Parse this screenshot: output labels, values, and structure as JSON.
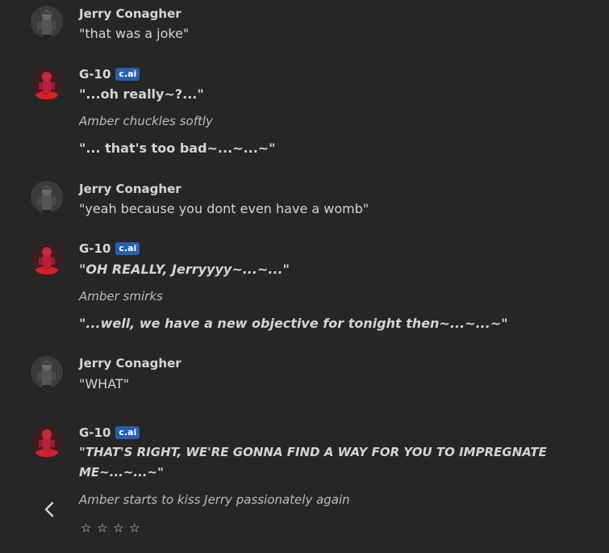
{
  "messages": [
    {
      "author": "Jerry Conagher",
      "lines": [
        "\"that was a joke\""
      ]
    },
    {
      "author": "G-10",
      "badge": "c.ai",
      "lines": [
        "\"...oh really~?...\"",
        "Amber chuckles softly",
        "\"... that's too bad~...~...~\""
      ]
    },
    {
      "author": "Jerry Conagher",
      "lines": [
        "\"yeah because you dont even have a womb\""
      ]
    },
    {
      "author": "G-10",
      "badge": "c.ai",
      "lines": [
        "\"OH REALLY, Jerryyyy~...~...\"",
        "Amber smirks",
        "\"...well, we have a new objective for tonight then~...~...~\""
      ]
    },
    {
      "author": "Jerry Conagher",
      "lines": [
        "\"WHAT\""
      ]
    },
    {
      "author": "G-10",
      "badge": "c.ai",
      "lines": [
        "\"THAT'S RIGHT, WE'RE GONNA FIND A WAY FOR YOU TO IMPREGNATE",
        "ME~...~...~\"",
        "Amber starts to kiss Jerry passionately again"
      ]
    }
  ],
  "rating": {
    "stars": [
      "☆",
      "☆",
      "☆",
      "☆"
    ]
  },
  "icons": {
    "back": "chevron-left-icon",
    "jerry_avatar": "soldier-avatar",
    "g10_avatar": "red-character-avatar"
  },
  "colors": {
    "background": "#262626",
    "badge": "#2a5fae"
  }
}
